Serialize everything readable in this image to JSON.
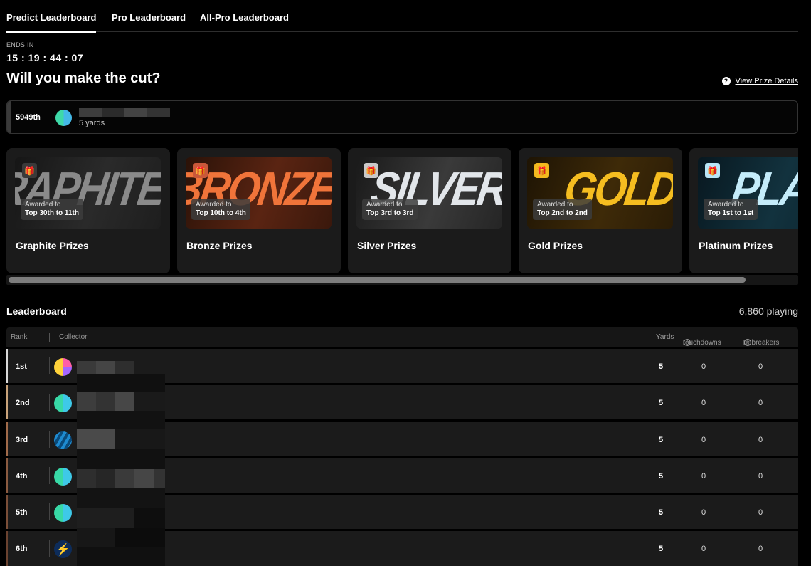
{
  "tabs": [
    "Predict Leaderboard",
    "Pro Leaderboard",
    "All-Pro Leaderboard"
  ],
  "countdown": {
    "label": "ENDS IN",
    "value": "15 : 19 : 44 : 07"
  },
  "headline": "Will you make the cut?",
  "prize_link": {
    "icon": "question-icon",
    "glyph": "?",
    "label": "View Prize Details"
  },
  "my_rank": {
    "rank": "5949th",
    "yards": "5 yards"
  },
  "prize_cards": [
    {
      "word": "GRAPHITE",
      "awarded": "Awarded to",
      "range": "Top 30th to 11th",
      "name": "Graphite Prizes",
      "color": "#6e6e6e"
    },
    {
      "word": "BRONZE",
      "awarded": "Awarded to",
      "range": "Top 10th to 4th",
      "name": "Bronze Prizes",
      "color": "#e0703a"
    },
    {
      "word": "SILVER",
      "awarded": "Awarded to",
      "range": "Top 3rd to 3rd",
      "name": "Silver Prizes",
      "color": "#d9dee4"
    },
    {
      "word": "GOLD",
      "awarded": "Awarded to",
      "range": "Top 2nd to 2nd",
      "name": "Gold Prizes",
      "color": "#f3b91e"
    },
    {
      "word": "PLATINUM",
      "awarded": "Awarded to",
      "range": "Top 1st to 1st",
      "name": "Platinum Prizes",
      "color": "#b9e6f7"
    }
  ],
  "leaderboard": {
    "title": "Leaderboard",
    "playing": "6,860 playing",
    "columns": {
      "rank": "Rank",
      "collector": "Collector",
      "yards": "Yards",
      "touchdowns": "Touchdowns",
      "tiebreakers": "Tiebreakers"
    },
    "rows": [
      {
        "rank": "1st",
        "yards": "5",
        "touchdowns": "0",
        "tiebreakers": "0",
        "accent": "#d9d9d9"
      },
      {
        "rank": "2nd",
        "yards": "5",
        "touchdowns": "0",
        "tiebreakers": "0",
        "accent": "#c8a27a"
      },
      {
        "rank": "3rd",
        "yards": "5",
        "touchdowns": "0",
        "tiebreakers": "0",
        "accent": "#a06a4a"
      },
      {
        "rank": "4th",
        "yards": "5",
        "touchdowns": "0",
        "tiebreakers": "0",
        "accent": "#8a5a40"
      },
      {
        "rank": "5th",
        "yards": "5",
        "touchdowns": "0",
        "tiebreakers": "0",
        "accent": "#7a4e38"
      },
      {
        "rank": "6th",
        "yards": "5",
        "touchdowns": "0",
        "tiebreakers": "0",
        "accent": "#6a4230"
      }
    ]
  }
}
